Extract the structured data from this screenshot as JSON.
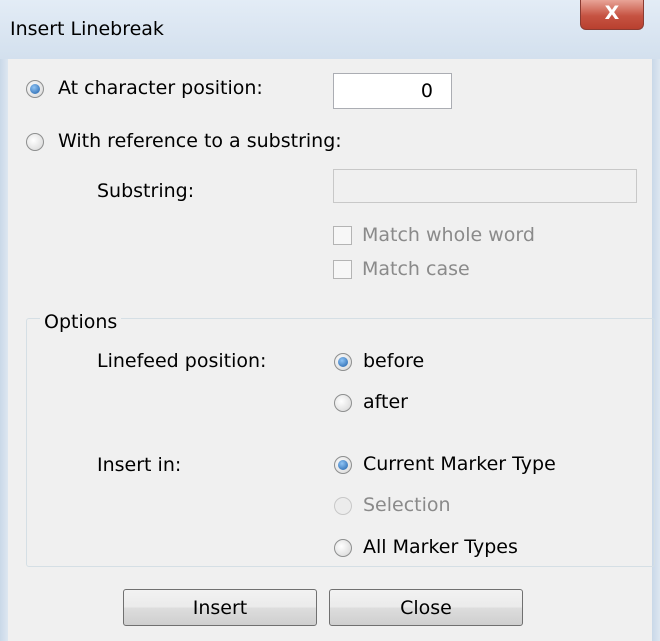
{
  "window": {
    "title": "Insert Linebreak",
    "close_symbol": "X"
  },
  "position_mode": {
    "at_char_label": "At character position:",
    "at_char_value": "0",
    "substring_label": "With reference to a substring:"
  },
  "substring": {
    "label": "Substring:",
    "value": "",
    "match_whole_word": "Match whole word",
    "match_case": "Match case"
  },
  "options": {
    "title": "Options",
    "linefeed_label": "Linefeed position:",
    "before": "before",
    "after": "after",
    "insert_in_label": "Insert in:",
    "current_marker": "Current Marker Type",
    "selection": "Selection",
    "all_markers": "All Marker Types"
  },
  "buttons": {
    "insert": "Insert",
    "close": "Close"
  }
}
